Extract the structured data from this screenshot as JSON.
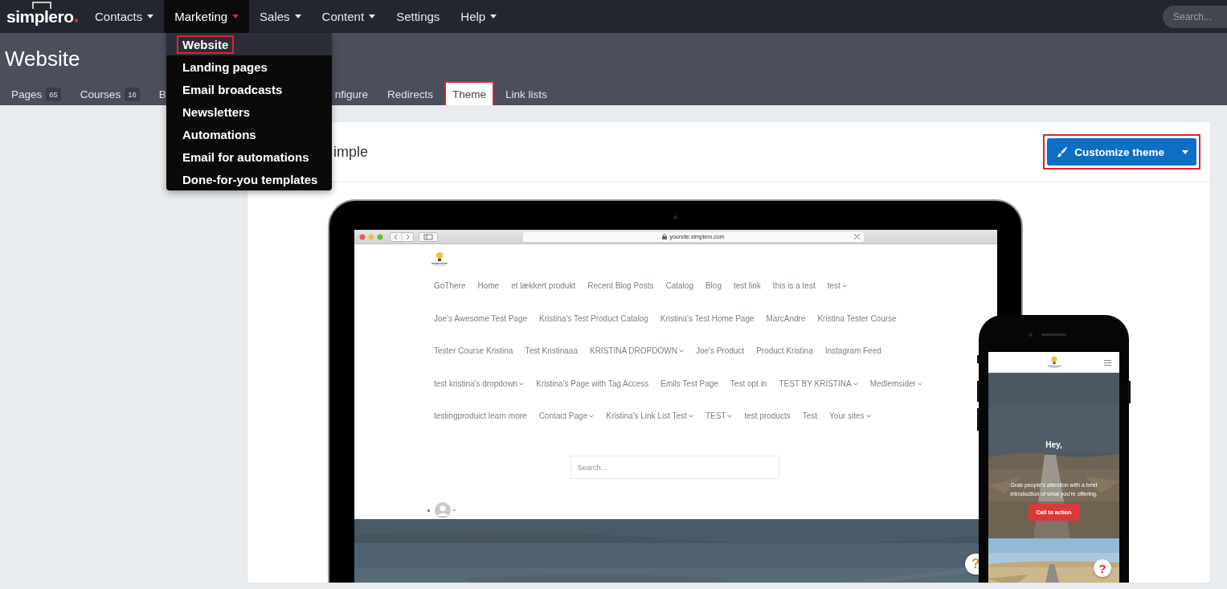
{
  "nav": {
    "logo": "simplero",
    "items": [
      {
        "label": "Contacts",
        "has_menu": true,
        "open": false
      },
      {
        "label": "Marketing",
        "has_menu": true,
        "open": true
      },
      {
        "label": "Sales",
        "has_menu": true,
        "open": false
      },
      {
        "label": "Content",
        "has_menu": true,
        "open": false
      },
      {
        "label": "Settings",
        "has_menu": false,
        "open": false
      },
      {
        "label": "Help",
        "has_menu": true,
        "open": false
      }
    ],
    "search": {
      "placeholder": "Search..."
    }
  },
  "marketing_menu": {
    "items": [
      {
        "label": "Website",
        "selected": true,
        "annotated": true
      },
      {
        "label": "Landing pages",
        "selected": false,
        "annotated": false
      },
      {
        "label": "Email broadcasts",
        "selected": false,
        "annotated": false
      },
      {
        "label": "Newsletters",
        "selected": false,
        "annotated": false
      },
      {
        "label": "Automations",
        "selected": false,
        "annotated": false
      },
      {
        "label": "Email for automations",
        "selected": false,
        "annotated": false
      },
      {
        "label": "Done-for-you templates",
        "selected": false,
        "annotated": false
      }
    ]
  },
  "page": {
    "title": "Website",
    "tabs": [
      {
        "label": "Pages",
        "count": "65",
        "selected": false,
        "annotated": false
      },
      {
        "label": "Courses",
        "count": "16",
        "selected": false,
        "annotated": false
      },
      {
        "label": "B",
        "selected": false,
        "annotated": false
      },
      {
        "label": "nfigure",
        "selected": false,
        "annotated": false
      },
      {
        "label": "Redirects",
        "selected": false,
        "annotated": false
      },
      {
        "label": "Theme",
        "selected": true,
        "annotated": true
      },
      {
        "label": "Link lists",
        "selected": false,
        "annotated": false
      }
    ]
  },
  "theme_card": {
    "title": "imple",
    "customize_button": {
      "label": "Customize theme",
      "annotated": true
    },
    "laptop": {
      "url": "yoursite.simplero.com",
      "nav_rows": [
        [
          {
            "label": "GoThere",
            "dropdown": false
          },
          {
            "label": "Home",
            "dropdown": false
          },
          {
            "label": "et lækkert produkt",
            "dropdown": false
          },
          {
            "label": "Recent Blog Posts",
            "dropdown": false
          },
          {
            "label": "Catalog",
            "dropdown": false
          },
          {
            "label": "Blog",
            "dropdown": false
          },
          {
            "label": "test link",
            "dropdown": false
          },
          {
            "label": "this is a test",
            "dropdown": false
          },
          {
            "label": "test",
            "dropdown": true
          }
        ],
        [
          {
            "label": "Joe's Awesome Test Page",
            "dropdown": false
          },
          {
            "label": "Kristina's Test Product Catalog",
            "dropdown": false
          },
          {
            "label": "Kristina's Test Home Page",
            "dropdown": false
          },
          {
            "label": "MarcAndre",
            "dropdown": false
          },
          {
            "label": "Kristina Tester Course",
            "dropdown": false
          }
        ],
        [
          {
            "label": "Tester Course Kristina",
            "dropdown": false
          },
          {
            "label": "Test Kristinaaa",
            "dropdown": false
          },
          {
            "label": "KRISTINA DROPDOWN",
            "dropdown": true
          },
          {
            "label": "Joe's Product",
            "dropdown": false
          },
          {
            "label": "Product Kristina",
            "dropdown": false
          },
          {
            "label": "Instagram Feed",
            "dropdown": false
          }
        ],
        [
          {
            "label": "test kristina's dropdown",
            "dropdown": true
          },
          {
            "label": "Kristina's Page with Tag Access",
            "dropdown": false
          },
          {
            "label": "Emils Test Page",
            "dropdown": false
          },
          {
            "label": "Test opt in",
            "dropdown": false
          },
          {
            "label": "TEST BY KRISTINA",
            "dropdown": true
          },
          {
            "label": "Medlemsider",
            "dropdown": true
          }
        ],
        [
          {
            "label": "testingproduict learn more",
            "dropdown": false
          },
          {
            "label": "Contact Page",
            "dropdown": true
          },
          {
            "label": "Kristina's Link List Test",
            "dropdown": true
          },
          {
            "label": "TEST",
            "dropdown": true
          },
          {
            "label": "test products",
            "dropdown": false
          },
          {
            "label": "Test",
            "dropdown": false
          },
          {
            "label": "Your sites",
            "dropdown": true
          }
        ]
      ],
      "search_placeholder": "Search...",
      "help": "?"
    },
    "phone": {
      "hero_title": "Hey,",
      "hero_text": "Grab people's attention with a brief introduction of what you're offering.",
      "cta": "Call to action",
      "help": "?"
    }
  }
}
